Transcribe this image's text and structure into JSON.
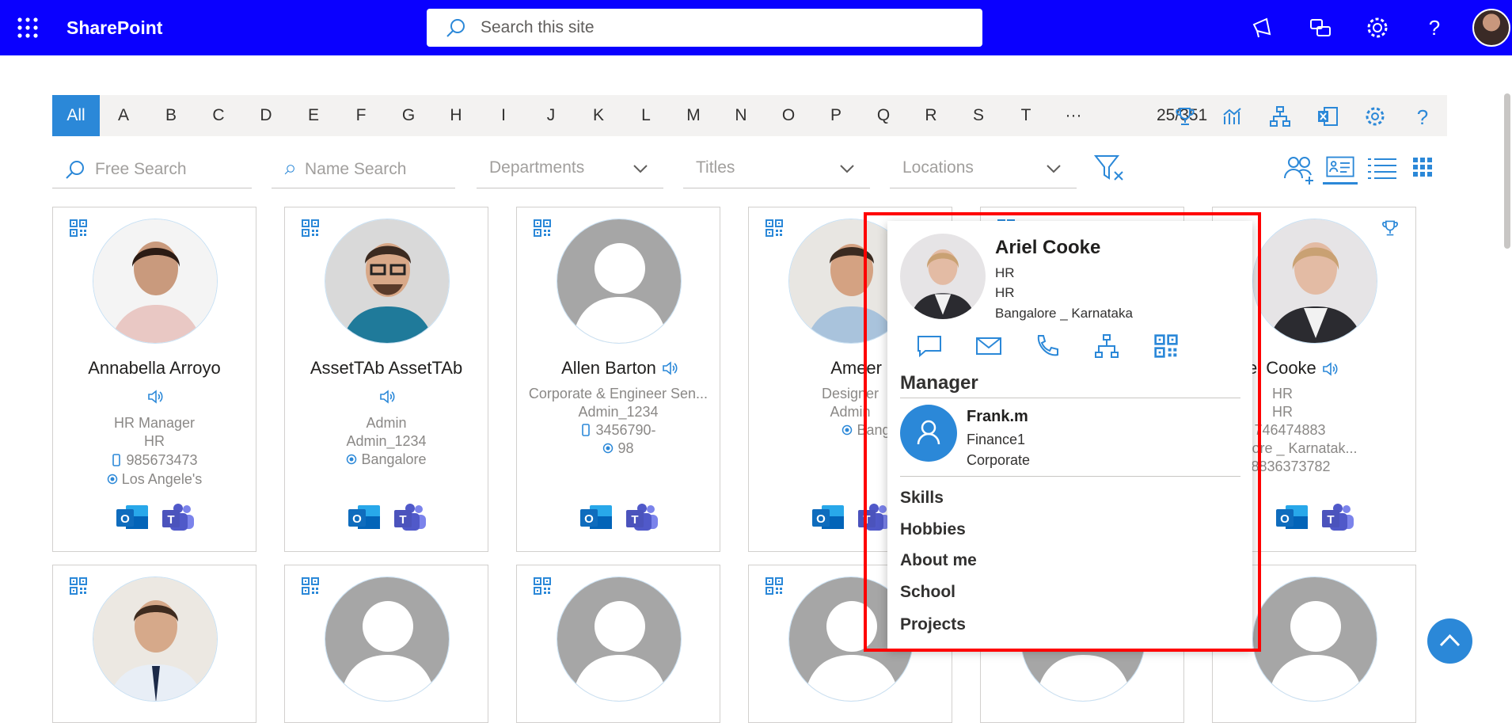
{
  "topbar": {
    "brand": "SharePoint",
    "search_placeholder": "Search this site",
    "icons": [
      "waffle-icon",
      "megaphone-icon",
      "chat-help-icon",
      "gear-icon",
      "question-icon",
      "avatar"
    ]
  },
  "alphabet": {
    "letters": [
      "All",
      "A",
      "B",
      "C",
      "D",
      "E",
      "F",
      "G",
      "H",
      "I",
      "J",
      "K",
      "L",
      "M",
      "N",
      "O",
      "P",
      "Q",
      "R",
      "S",
      "T"
    ],
    "more": "···",
    "count": "25/351",
    "icons": [
      "trophy-icon",
      "chart-icon",
      "org-chart-icon",
      "excel-icon",
      "gear-icon",
      "question-icon"
    ]
  },
  "filters": {
    "free_search": "Free Search",
    "name_search": "Name Search",
    "departments": "Departments",
    "titles": "Titles",
    "locations": "Locations"
  },
  "cards": [
    {
      "name": "Annabella Arroyo",
      "lines": [
        "HR Manager",
        "HR",
        "985673473",
        "Los Angele's"
      ]
    },
    {
      "name": "AssetTAb AssetTAb",
      "lines": [
        "Admin",
        "Admin_1234",
        "Bangalore"
      ]
    },
    {
      "name": "Allen Barton",
      "lines": [
        "Corporate & Engineer Sen...",
        "Admin_1234",
        "3456790-",
        "98"
      ]
    },
    {
      "name": "Ameer Brand",
      "lines": [
        "Designer",
        "Admin",
        "Bangalore"
      ]
    },
    {
      "name": "Ariel Cooke",
      "lines": [
        "HR",
        "HR",
        "746474883",
        "Bangalore _ Karnatak...",
        "8836373782"
      ]
    }
  ],
  "popup": {
    "name": "Ariel Cooke",
    "dept": "HR",
    "title": "HR",
    "location": "Bangalore _ Karnataka",
    "manager_heading": "Manager",
    "manager": {
      "name": "Frank.m",
      "dept": "Finance1",
      "org": "Corporate"
    },
    "links": [
      "Skills",
      "Hobbies",
      "About me",
      "School",
      "Projects"
    ]
  },
  "colors": {
    "brand": "#0a00ff",
    "accent": "#2b88d8",
    "highlight": "#ff0000"
  }
}
